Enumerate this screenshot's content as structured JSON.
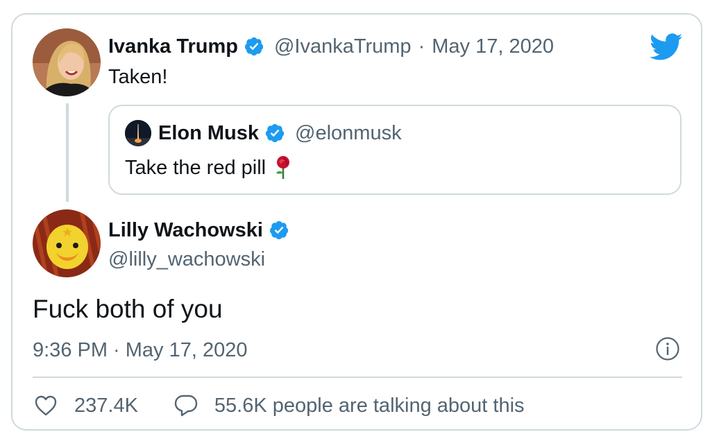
{
  "parent_tweet": {
    "name": "Ivanka Trump",
    "handle": "@IvankaTrump",
    "separator": "·",
    "date": "May 17, 2020",
    "text": "Taken!",
    "avatar_icon": "ivanka-avatar"
  },
  "quoted_tweet": {
    "name": "Elon Musk",
    "handle": "@elonmusk",
    "text": "Take the red pill",
    "emoji_icon": "rose-emoji",
    "avatar_icon": "rocket-launch-avatar"
  },
  "main_tweet": {
    "name": "Lilly Wachowski",
    "handle": "@lilly_wachowski",
    "text": "Fuck both of you",
    "timestamp": "9:36 PM · May 17, 2020",
    "avatar_icon": "yellow-duck-avatar"
  },
  "actions": {
    "likes": "237.4K",
    "conversation": "55.6K people are talking about this"
  },
  "colors": {
    "twitter_blue": "#1d9bf0",
    "border": "#cfd9de",
    "text": "#0f1419",
    "secondary_text": "#536471",
    "rose_red": "#c8102e"
  },
  "icons": [
    "twitter-bird-icon",
    "verified-badge-icon",
    "info-icon",
    "heart-icon",
    "speech-bubble-icon"
  ]
}
